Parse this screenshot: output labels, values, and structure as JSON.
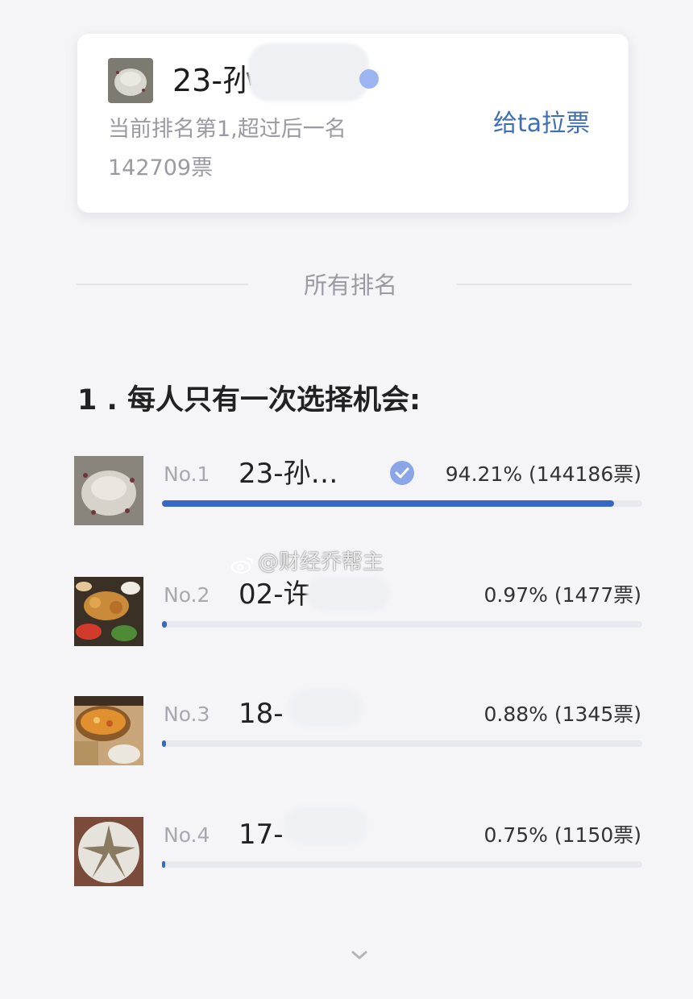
{
  "current": {
    "name": "23-孙",
    "rank_text": "当前排名第1,超过后一名",
    "lead_votes": "142709票",
    "vote_button": "给ta拉票"
  },
  "section_title": "所有排名",
  "question": "1 . 每人只有一次选择机会:",
  "entries": [
    {
      "rank": "No.1",
      "name": "23-孙…",
      "percent_text": "94.21% (144186票)",
      "share": 0.9421,
      "verified": true
    },
    {
      "rank": "No.2",
      "name": "02-许",
      "percent_text": "0.97% (1477票)",
      "share": 0.0097,
      "verified": false
    },
    {
      "rank": "No.3",
      "name": "18-",
      "percent_text": "0.88% (1345票)",
      "share": 0.0088,
      "verified": false
    },
    {
      "rank": "No.4",
      "name": "17-",
      "percent_text": "0.75% (1150票)",
      "share": 0.0075,
      "verified": false
    }
  ],
  "watermark": "@财经乔帮主",
  "colors": {
    "accent": "#3769c4",
    "link": "#3e6fb5",
    "muted": "#9a9aa2"
  }
}
